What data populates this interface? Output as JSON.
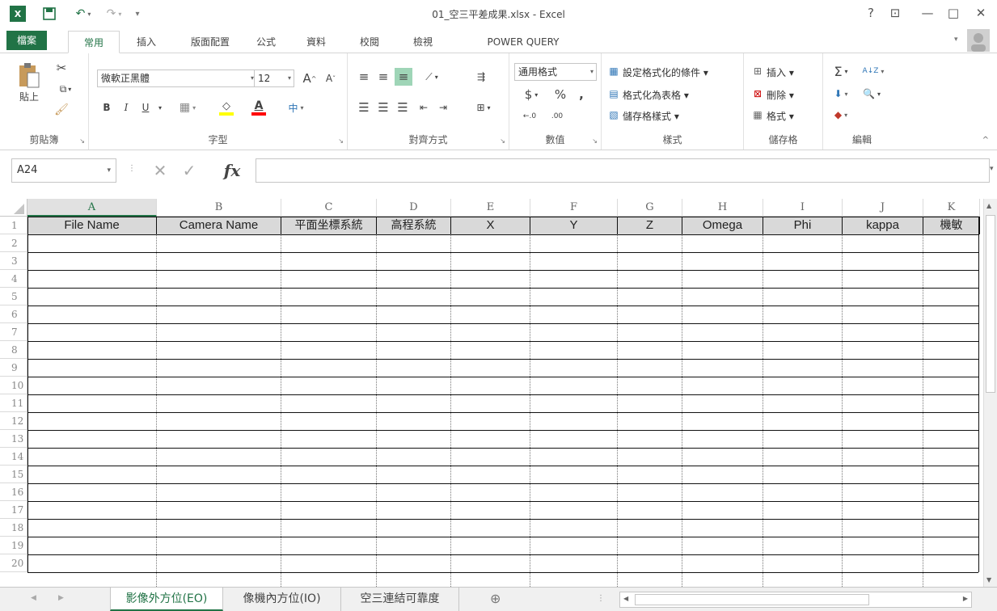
{
  "window": {
    "title": "01_空三平差成果.xlsx - Excel",
    "help": "?",
    "restore_ribbon": "⊡",
    "minimize": "—",
    "maximize": "□",
    "close": "✕"
  },
  "quick_access": {
    "app_icon": "X",
    "save": "💾",
    "undo": "↶",
    "redo": "↷",
    "customize": "▾"
  },
  "tabs": [
    "檔案",
    "常用",
    "插入",
    "版面配置",
    "公式",
    "資料",
    "校閱",
    "檢視",
    "POWER QUERY"
  ],
  "active_tab": "常用",
  "ribbon": {
    "clipboard": {
      "paste": "貼上",
      "label": "剪貼簿"
    },
    "font": {
      "name": "微軟正黑體",
      "size": "12",
      "bold": "B",
      "italic": "I",
      "underline": "U",
      "grow": "A",
      "shrink": "A",
      "phonetic": "中",
      "font_color": "A",
      "label": "字型"
    },
    "alignment": {
      "label": "對齊方式"
    },
    "number": {
      "format": "通用格式",
      "currency": "$",
      "percent": "%",
      "comma": ",",
      "inc_dec": "←.0",
      "dec_dec": ".00",
      "label": "數值"
    },
    "styles": {
      "conditional": "設定格式化的條件 ▾",
      "as_table": "格式化為表格 ▾",
      "cell_styles": "儲存格樣式 ▾",
      "label": "樣式"
    },
    "cells": {
      "insert": "插入 ▾",
      "delete": "刪除 ▾",
      "format": "格式 ▾",
      "label": "儲存格"
    },
    "editing": {
      "sum": "Σ",
      "sort": "A↓Z",
      "label": "編輯"
    }
  },
  "formula_bar": {
    "name_box": "A24",
    "cancel": "✕",
    "enter": "✓",
    "fx": "fx",
    "value": ""
  },
  "columns": [
    "A",
    "B",
    "C",
    "D",
    "E",
    "F",
    "G",
    "H",
    "I",
    "J",
    "K"
  ],
  "selected_column": "A",
  "header_row": [
    "File Name",
    "Camera Name",
    "平面坐標系統",
    "高程系統",
    "X",
    "Y",
    "Z",
    "Omega",
    "Phi",
    "kappa",
    "機敏"
  ],
  "rows": [
    "1",
    "2",
    "3",
    "4",
    "5",
    "6",
    "7",
    "8",
    "9",
    "10",
    "11",
    "12",
    "13",
    "14",
    "15",
    "16",
    "17",
    "18",
    "19",
    "20"
  ],
  "sheets": [
    "影像外方位(EO)",
    "像機內方位(IO)",
    "空三連結可靠度"
  ],
  "active_sheet": "影像外方位(EO)",
  "add_sheet": "⊕"
}
